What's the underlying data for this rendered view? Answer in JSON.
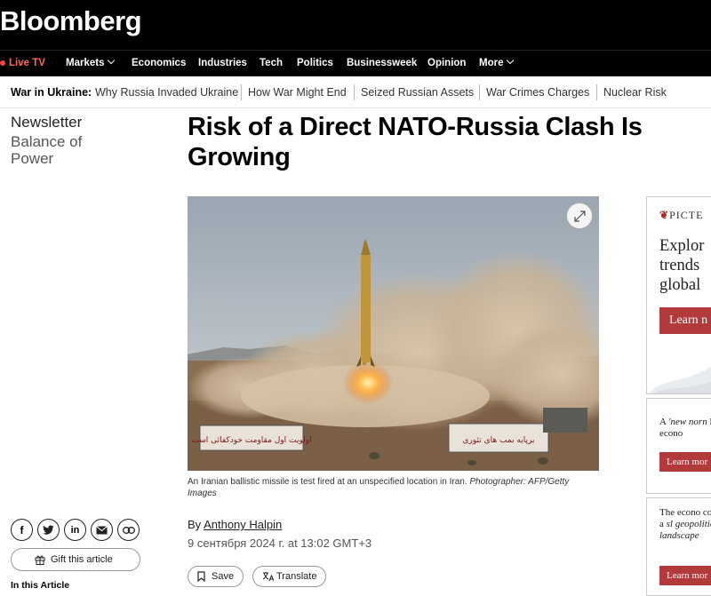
{
  "header": {
    "logo": "Bloomberg"
  },
  "nav": {
    "live": "Live TV",
    "items": [
      "Markets",
      "Economics",
      "Industries",
      "Tech",
      "Politics",
      "Businessweek",
      "Opinion",
      "More"
    ]
  },
  "subnav": {
    "title": "War in Ukraine:",
    "links": [
      "Why Russia Invaded Ukraine",
      "How War Might End",
      "Seized Russian Assets",
      "War Crimes Charges",
      "Nuclear Risk"
    ]
  },
  "sidebar": {
    "newsletter": "Newsletter",
    "newsletter_name": "Balance of Power"
  },
  "article": {
    "headline": "Risk of a Direct NATO-Russia Clash Is Growing",
    "caption": "An Iranian ballistic missile is test fired at an unspecified location in Iran.",
    "caption_credit": "Photographer: AFP/Getty Images",
    "by": "By",
    "author": "Anthony Halpin",
    "date": "9 сентября 2024 г. at 13:02 GMT+3",
    "save_label": "Save",
    "translate_label": "Translate",
    "banner_left": "اولویت اول مقاومت خودکفائی است",
    "banner_right": "برپایه بمب های تئوری"
  },
  "share": {
    "icons": [
      "facebook-icon",
      "twitter-icon",
      "linkedin-icon",
      "email-icon",
      "link-icon"
    ],
    "gift_label": "Gift this article",
    "in_this_article": "In this Article"
  },
  "ads": {
    "ad1": {
      "brand": "PICTE",
      "headline": "Explor trends global",
      "button": "Learn n"
    },
    "ad2": {
      "text_pre": "A ",
      "text_em": "'new norn",
      "text_post": " large econo",
      "button": "Learn mor"
    },
    "ad3": {
      "text_pre": "The econo costs of a ",
      "text_em": "sl geopolitical landscape",
      "button": "Learn mor"
    }
  },
  "colors": {
    "live": "#ff433d",
    "ad_button": "#b23a3a"
  }
}
